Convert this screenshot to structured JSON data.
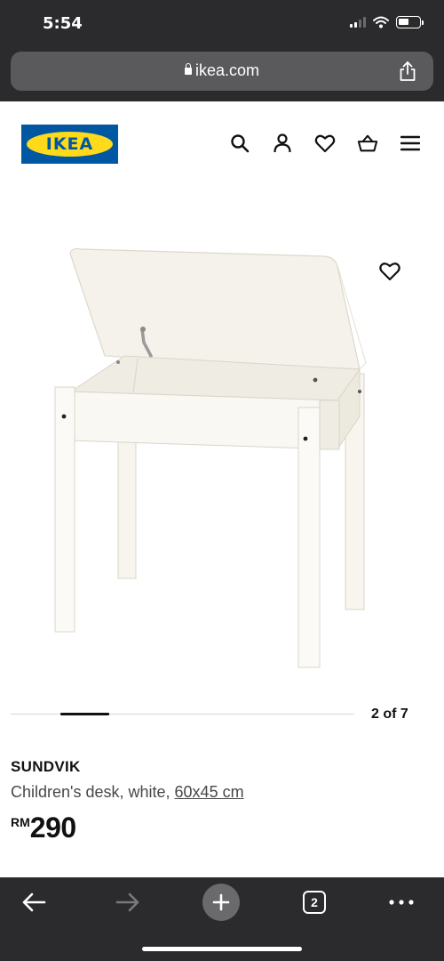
{
  "status_bar": {
    "time": "5:54"
  },
  "browser": {
    "url": "ikea.com",
    "tab_count": "2"
  },
  "header": {
    "logo_text": "IKEA",
    "icons": [
      "search-icon",
      "account-icon",
      "wishlist-icon",
      "basket-icon",
      "menu-icon"
    ]
  },
  "gallery": {
    "pager_text": "2 of 7",
    "current_index": 2,
    "total": 7
  },
  "product": {
    "name": "SUNDVIK",
    "description": "Children's desk, white, ",
    "size": "60x45 cm",
    "price_currency": "RM",
    "price_value": "290"
  },
  "colors": {
    "ikea_blue": "#0058a3",
    "ikea_yellow": "#ffda1a",
    "chrome_dark": "#2b2b2d"
  }
}
